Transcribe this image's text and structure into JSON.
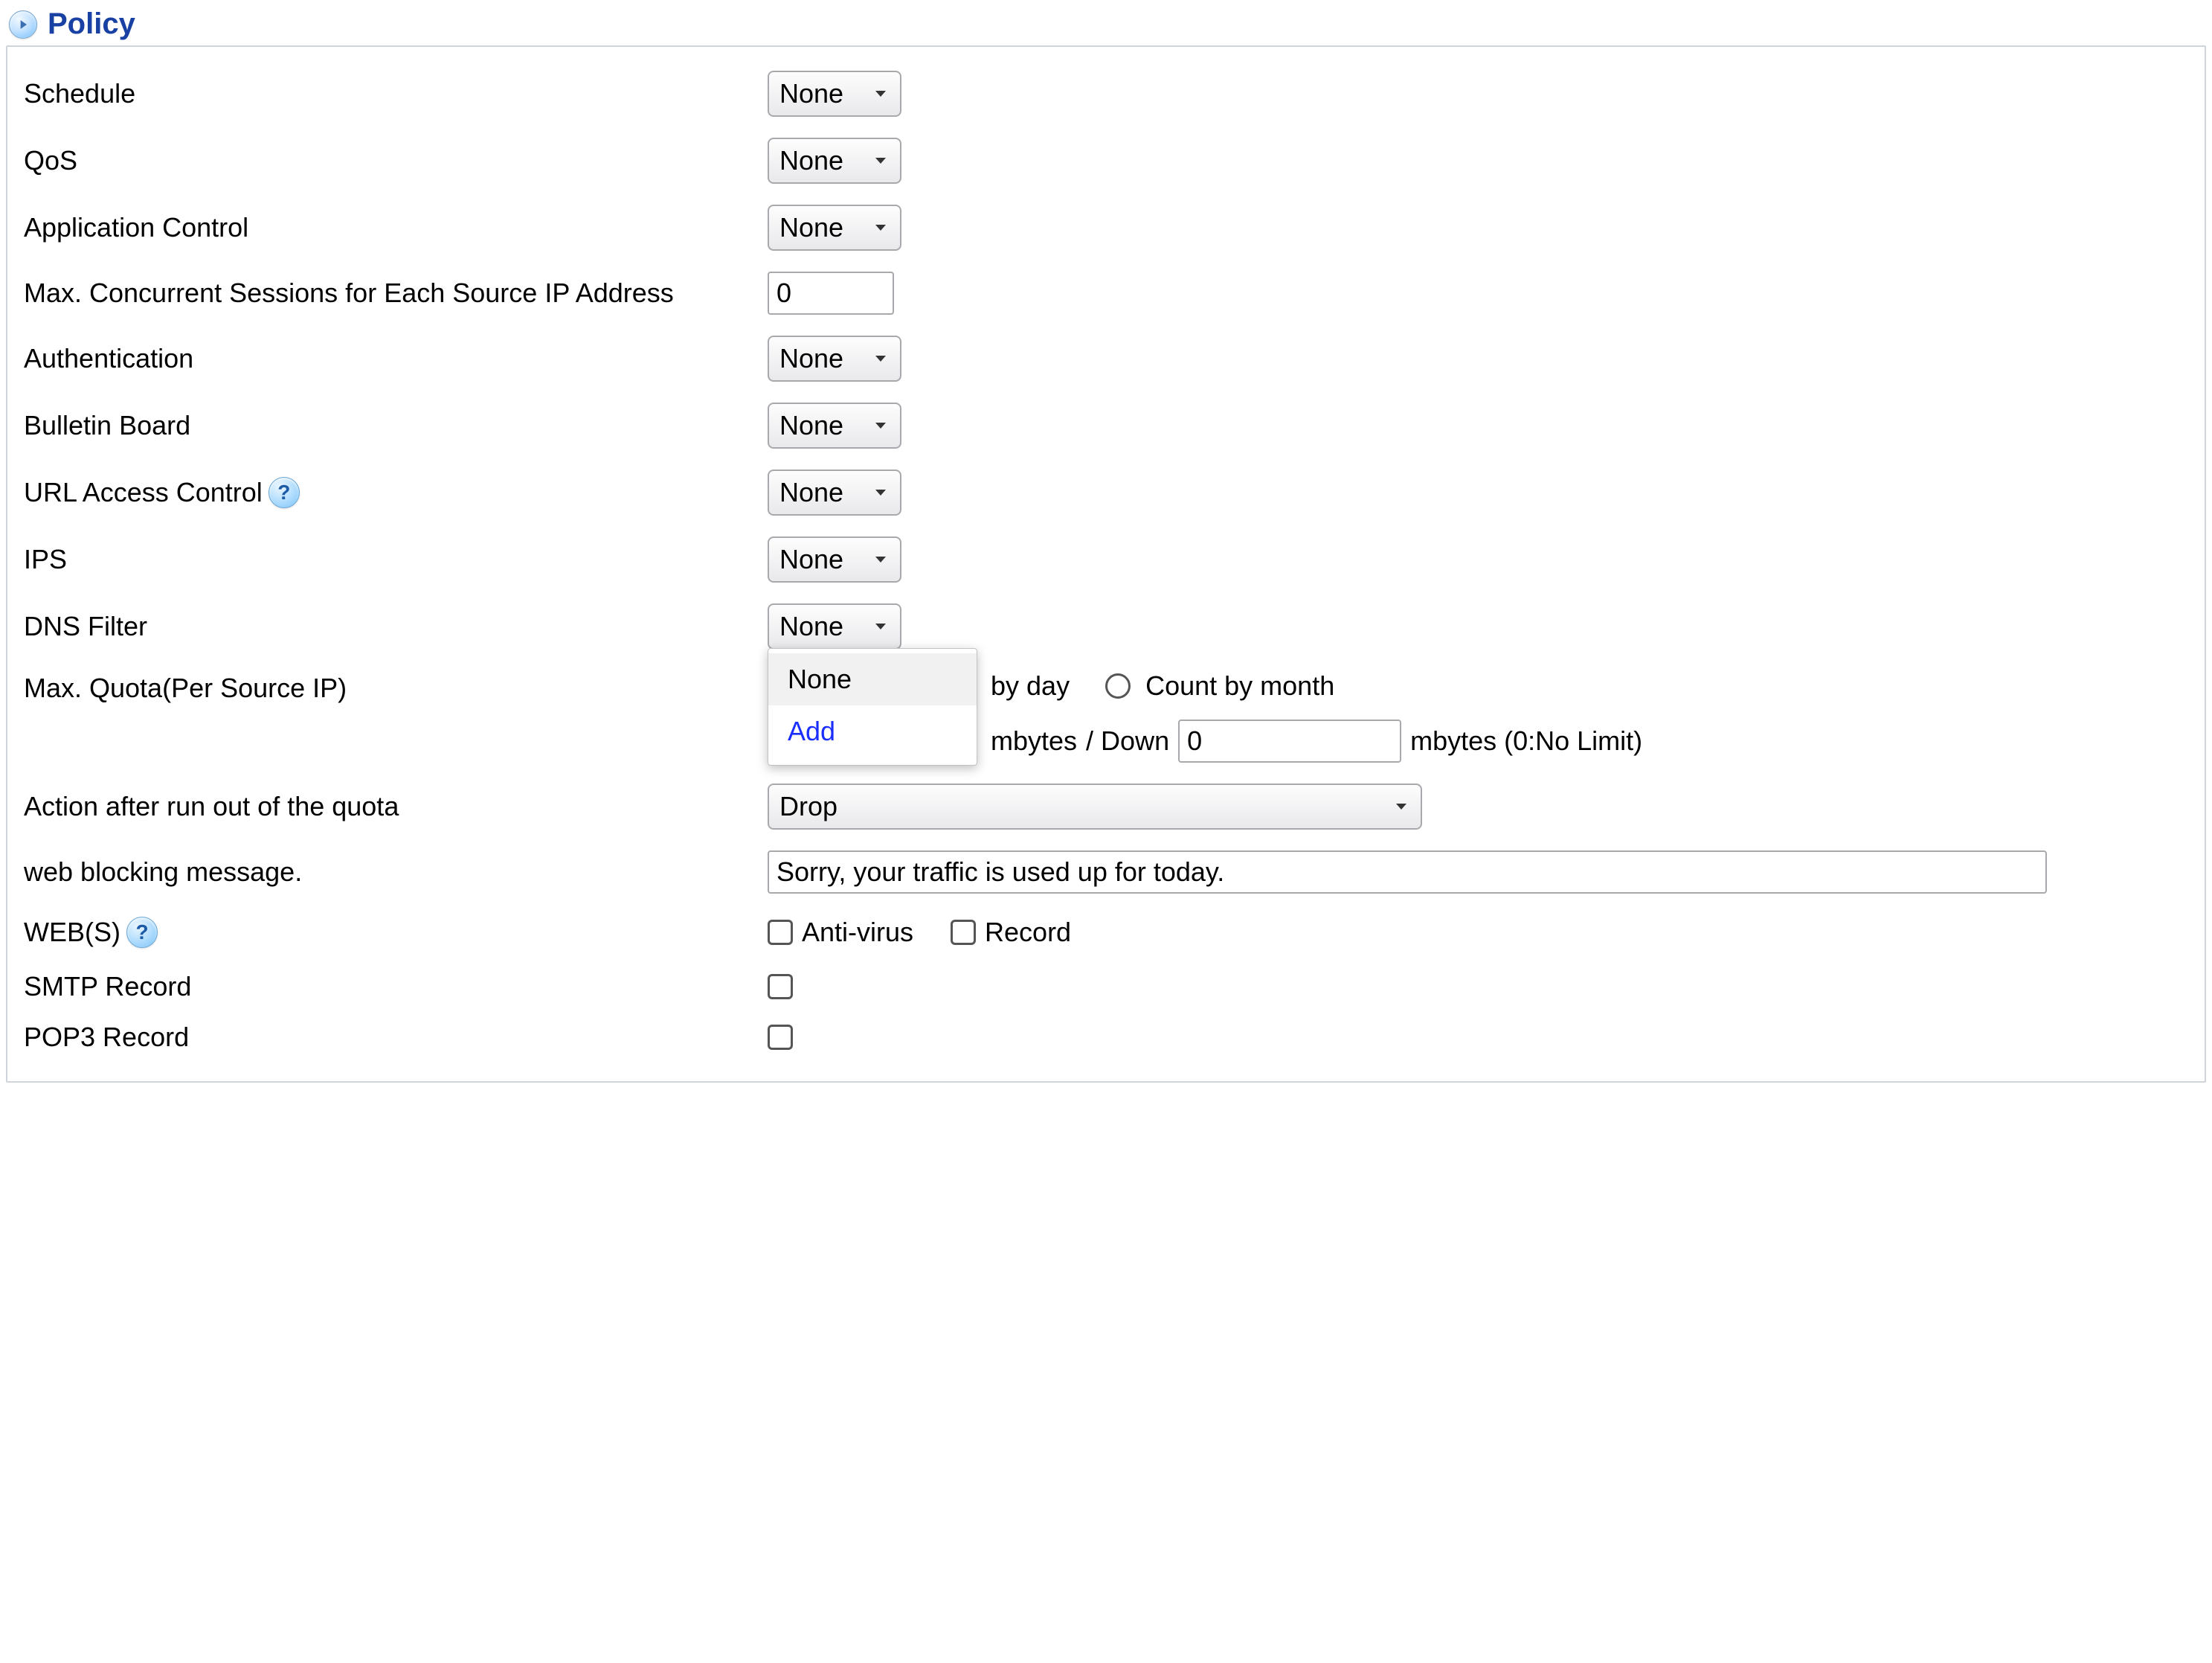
{
  "section": {
    "title": "Policy"
  },
  "options": {
    "none": "None"
  },
  "fields": {
    "schedule": {
      "label": "Schedule",
      "value": "None"
    },
    "qos": {
      "label": "QoS",
      "value": "None"
    },
    "appctrl": {
      "label": "Application Control",
      "value": "None"
    },
    "sessions": {
      "label": "Max. Concurrent Sessions for Each Source IP Address",
      "value": "0"
    },
    "auth": {
      "label": "Authentication",
      "value": "None"
    },
    "bulletin": {
      "label": "Bulletin Board",
      "value": "None"
    },
    "urlac": {
      "label": "URL Access Control",
      "value": "None"
    },
    "ips": {
      "label": "IPS",
      "value": "None"
    },
    "dnsfilter": {
      "label": "DNS Filter",
      "value": "None",
      "dropdown": {
        "opt_none": "None",
        "opt_add": "Add"
      }
    },
    "quota": {
      "label": "Max. Quota(Per Source IP)",
      "radio_day": "by day",
      "radio_month": "Count by month",
      "unit_mbytes": "mbytes",
      "down_label": "/ Down",
      "down_value": "0",
      "hint": "mbytes (0:No Limit)"
    },
    "action": {
      "label": "Action after run out of the quota",
      "value": "Drop"
    },
    "webmsg": {
      "label": "web blocking message.",
      "value": "Sorry, your traffic is used up for today."
    },
    "webs": {
      "label": "WEB(S)",
      "antivirus": "Anti-virus",
      "record": "Record"
    },
    "smtp": {
      "label": "SMTP Record"
    },
    "pop3": {
      "label": "POP3 Record"
    }
  }
}
